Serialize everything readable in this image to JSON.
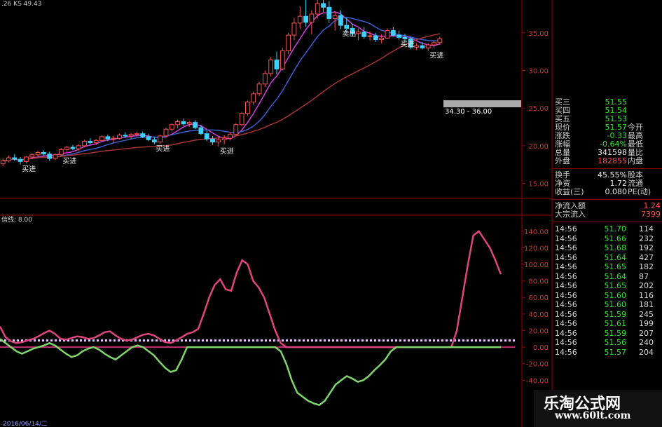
{
  "chart_data": [
    {
      "type": "candlestick",
      "price_axis": {
        "ticks": [
          35.0,
          30.0,
          25.0,
          20.0,
          15.0
        ],
        "tick_labels": [
          "35.00",
          "30.00",
          "25.00",
          "20.00",
          "15.00"
        ],
        "ylim": [
          13.0,
          37.5
        ]
      },
      "top_label": ".26 KS 49.43",
      "price_range_box": "34.30 - 36.00",
      "signal_labels": [
        "买进",
        "买进",
        "买进",
        "买进",
        "卖出",
        "买进",
        "买进"
      ],
      "candles": [
        [
          17.6,
          18.3,
          17.3,
          18.0
        ],
        [
          18.0,
          18.7,
          17.8,
          18.4
        ],
        [
          18.4,
          18.9,
          18.0,
          18.2
        ],
        [
          18.2,
          18.5,
          17.5,
          17.9
        ],
        [
          17.9,
          18.6,
          17.7,
          18.5
        ],
        [
          18.5,
          19.0,
          18.2,
          18.8
        ],
        [
          18.8,
          19.3,
          18.5,
          19.1
        ],
        [
          19.1,
          19.4,
          18.7,
          18.9
        ],
        [
          18.9,
          19.2,
          18.0,
          18.3
        ],
        [
          18.3,
          19.0,
          18.1,
          18.8
        ],
        [
          18.8,
          19.7,
          18.6,
          19.5
        ],
        [
          19.5,
          20.0,
          19.2,
          19.8
        ],
        [
          19.8,
          20.1,
          19.4,
          19.6
        ],
        [
          19.6,
          20.2,
          19.3,
          20.0
        ],
        [
          20.0,
          20.8,
          19.8,
          20.6
        ],
        [
          20.6,
          21.0,
          20.2,
          20.4
        ],
        [
          20.4,
          20.9,
          20.1,
          20.7
        ],
        [
          20.7,
          21.4,
          20.5,
          21.2
        ],
        [
          21.2,
          21.5,
          20.6,
          20.9
        ],
        [
          20.9,
          21.3,
          20.4,
          21.0
        ],
        [
          21.0,
          21.6,
          20.8,
          21.4
        ],
        [
          21.4,
          21.8,
          21.0,
          21.3
        ],
        [
          21.3,
          21.7,
          20.9,
          21.5
        ],
        [
          21.5,
          21.9,
          21.2,
          21.6
        ],
        [
          21.6,
          21.9,
          21.0,
          21.2
        ],
        [
          21.2,
          21.6,
          20.6,
          20.8
        ],
        [
          20.8,
          21.2,
          20.2,
          20.5
        ],
        [
          20.5,
          21.5,
          20.3,
          21.3
        ],
        [
          21.3,
          22.4,
          21.1,
          22.2
        ],
        [
          22.2,
          23.0,
          21.9,
          22.8
        ],
        [
          22.8,
          23.5,
          22.3,
          23.2
        ],
        [
          23.2,
          23.6,
          22.6,
          22.9
        ],
        [
          22.9,
          23.3,
          22.5,
          23.1
        ],
        [
          23.1,
          23.4,
          22.2,
          22.4
        ],
        [
          22.4,
          22.8,
          21.4,
          21.6
        ],
        [
          21.6,
          22.0,
          20.6,
          20.9
        ],
        [
          20.9,
          21.3,
          20.1,
          20.5
        ],
        [
          20.5,
          21.2,
          19.9,
          20.8
        ],
        [
          20.8,
          21.4,
          20.2,
          21.0
        ],
        [
          21.0,
          21.8,
          20.7,
          21.5
        ],
        [
          21.5,
          23.0,
          21.3,
          22.8
        ],
        [
          22.8,
          24.5,
          22.6,
          24.3
        ],
        [
          24.3,
          26.0,
          24.0,
          25.8
        ],
        [
          25.8,
          27.2,
          25.4,
          26.9
        ],
        [
          26.9,
          28.5,
          26.6,
          28.2
        ],
        [
          28.2,
          30.0,
          27.8,
          29.6
        ],
        [
          29.6,
          31.8,
          29.2,
          31.4
        ],
        [
          31.4,
          32.5,
          29.5,
          30.2
        ],
        [
          30.2,
          33.0,
          30.0,
          32.6
        ],
        [
          32.6,
          35.0,
          32.2,
          34.7
        ],
        [
          34.7,
          37.0,
          34.0,
          36.3
        ],
        [
          36.3,
          38.5,
          35.5,
          37.2
        ],
        [
          37.2,
          39.5,
          35.8,
          36.4
        ],
        [
          36.4,
          38.0,
          34.8,
          37.5
        ],
        [
          37.5,
          39.6,
          36.9,
          38.9
        ],
        [
          38.9,
          40.6,
          37.8,
          38.4
        ],
        [
          38.4,
          39.2,
          36.3,
          36.9
        ],
        [
          36.9,
          37.8,
          35.3,
          37.3
        ],
        [
          37.3,
          38.0,
          35.5,
          36.0
        ],
        [
          36.0,
          37.0,
          35.0,
          35.6
        ],
        [
          35.6,
          36.2,
          34.5,
          34.9
        ],
        [
          34.9,
          35.6,
          34.0,
          35.1
        ],
        [
          35.1,
          35.8,
          34.2,
          34.5
        ],
        [
          34.5,
          35.2,
          34.0,
          34.6
        ],
        [
          34.6,
          35.0,
          33.8,
          34.1
        ],
        [
          34.1,
          34.8,
          33.6,
          34.3
        ],
        [
          34.3,
          35.6,
          34.2,
          35.3
        ],
        [
          35.3,
          35.8,
          34.5,
          34.7
        ],
        [
          34.7,
          35.3,
          34.1,
          34.4
        ],
        [
          34.4,
          34.9,
          33.8,
          34.2
        ],
        [
          34.2,
          34.5,
          32.8,
          33.1
        ],
        [
          33.1,
          33.6,
          32.7,
          33.3
        ],
        [
          33.3,
          33.8,
          32.8,
          33.0
        ],
        [
          33.0,
          33.6,
          32.6,
          33.4
        ],
        [
          33.4,
          34.0,
          33.0,
          33.7
        ],
        [
          33.7,
          34.5,
          33.4,
          34.2
        ]
      ]
    },
    {
      "type": "line",
      "label": "信线: 8.00",
      "ylim": [
        -55,
        150
      ],
      "ticks": [
        140,
        120,
        100,
        80,
        60,
        40,
        20,
        0,
        -20,
        -40
      ],
      "tick_labels": [
        "140.00",
        "120.00",
        "100.00",
        "80.00",
        "60.00",
        "40.00",
        "20.00",
        "0.00",
        "-20.00",
        "-40.00"
      ],
      "reference_line": 8.0,
      "series": [
        {
          "color": "#e0447e",
          "values": [
            25,
            12,
            7,
            5,
            6,
            8,
            10,
            13,
            17,
            20,
            16,
            10,
            9,
            11,
            13,
            12,
            10,
            11,
            14,
            18,
            19,
            14,
            10,
            8,
            9,
            12,
            15,
            16,
            14,
            10,
            6,
            5,
            8,
            12,
            16,
            18,
            22,
            40,
            60,
            75,
            82,
            70,
            68,
            90,
            105,
            100,
            80,
            72,
            60,
            40,
            20,
            5,
            0,
            0,
            0,
            0,
            0,
            0,
            0,
            0,
            0,
            0,
            0,
            0,
            0,
            0,
            0,
            0,
            0,
            0,
            0,
            0,
            0,
            0,
            0,
            0,
            0,
            0,
            0,
            0,
            0,
            0,
            0,
            20,
            60,
            100,
            135,
            140,
            130,
            120,
            105,
            88
          ]
        },
        {
          "color": "#7fd66a",
          "values": [
            10,
            5,
            0,
            -5,
            -8,
            -5,
            -2,
            0,
            2,
            5,
            2,
            -3,
            -8,
            -12,
            -10,
            -5,
            -2,
            0,
            -3,
            -8,
            -12,
            -15,
            -10,
            -5,
            0,
            2,
            0,
            -5,
            -10,
            -18,
            -25,
            -30,
            -28,
            -15,
            0,
            0,
            0,
            0,
            0,
            0,
            0,
            0,
            0,
            0,
            0,
            0,
            0,
            0,
            0,
            0,
            0,
            -5,
            -20,
            -40,
            -55,
            -60,
            -65,
            -68,
            -70,
            -65,
            -55,
            -45,
            -40,
            -35,
            -38,
            -42,
            -40,
            -35,
            -28,
            -22,
            -15,
            -5,
            0,
            0,
            0,
            0,
            0,
            0,
            0,
            0,
            0,
            0,
            0,
            0,
            0,
            0,
            0,
            0,
            0,
            0,
            0,
            0
          ]
        }
      ]
    }
  ],
  "quote_panel": {
    "rows": [
      {
        "label": "买三",
        "value": "51.55",
        "label2": "",
        "value2": ""
      },
      {
        "label": "买四",
        "value": "51.54",
        "label2": "",
        "value2": ""
      },
      {
        "label": "买五",
        "value": "51.53",
        "label2": "",
        "value2": ""
      },
      {
        "label": "现价",
        "value": "51.57",
        "label2": "今开",
        "value2": ""
      },
      {
        "label": "涨跌",
        "value": "-0.33",
        "label2": "最高",
        "value2": ""
      },
      {
        "label": "涨幅",
        "value": "-0.64%",
        "label2": "最低",
        "value2": ""
      },
      {
        "label": "总量",
        "value": "341598",
        "label2": "量比",
        "value2": ""
      },
      {
        "label": "外盘",
        "value": "182855",
        "label2": "内盘",
        "value2": ""
      }
    ],
    "rows2": [
      {
        "label": "换手",
        "value": "45.55%",
        "label2": "股本",
        "value2": ""
      },
      {
        "label": "净资",
        "value": "1.72",
        "label2": "流通",
        "value2": ""
      },
      {
        "label": "收益(三)",
        "value": "0.080",
        "label2": "PE(动)",
        "value2": ""
      }
    ],
    "flow": [
      {
        "label": "净流入额",
        "value": "1.24"
      },
      {
        "label": "大宗流入",
        "value": "7399"
      }
    ],
    "ticks": [
      {
        "time": "14:56",
        "price": "51.70",
        "vol": "114"
      },
      {
        "time": "14:56",
        "price": "51.66",
        "vol": "232"
      },
      {
        "time": "14:56",
        "price": "51.68",
        "vol": "192"
      },
      {
        "time": "14:56",
        "price": "51.64",
        "vol": "427"
      },
      {
        "time": "14:56",
        "price": "51.65",
        "vol": "182"
      },
      {
        "time": "14:56",
        "price": "51.64",
        "vol": "87"
      },
      {
        "time": "14:56",
        "price": "51.65",
        "vol": "202"
      },
      {
        "time": "14:56",
        "price": "51.60",
        "vol": "116"
      },
      {
        "time": "14:56",
        "price": "51.60",
        "vol": "181"
      },
      {
        "time": "14:56",
        "price": "51.59",
        "vol": "245"
      },
      {
        "time": "14:56",
        "price": "51.61",
        "vol": "199"
      },
      {
        "time": "14:56",
        "price": "51.59",
        "vol": "207"
      },
      {
        "time": "14:56",
        "price": "51.56",
        "vol": "240"
      },
      {
        "time": "14:56",
        "price": "51.57",
        "vol": "204"
      }
    ]
  },
  "bottom_date": "2016/06/14/二",
  "watermark": {
    "line1": "乐淘公式网",
    "line2": "www.60lt.com"
  }
}
